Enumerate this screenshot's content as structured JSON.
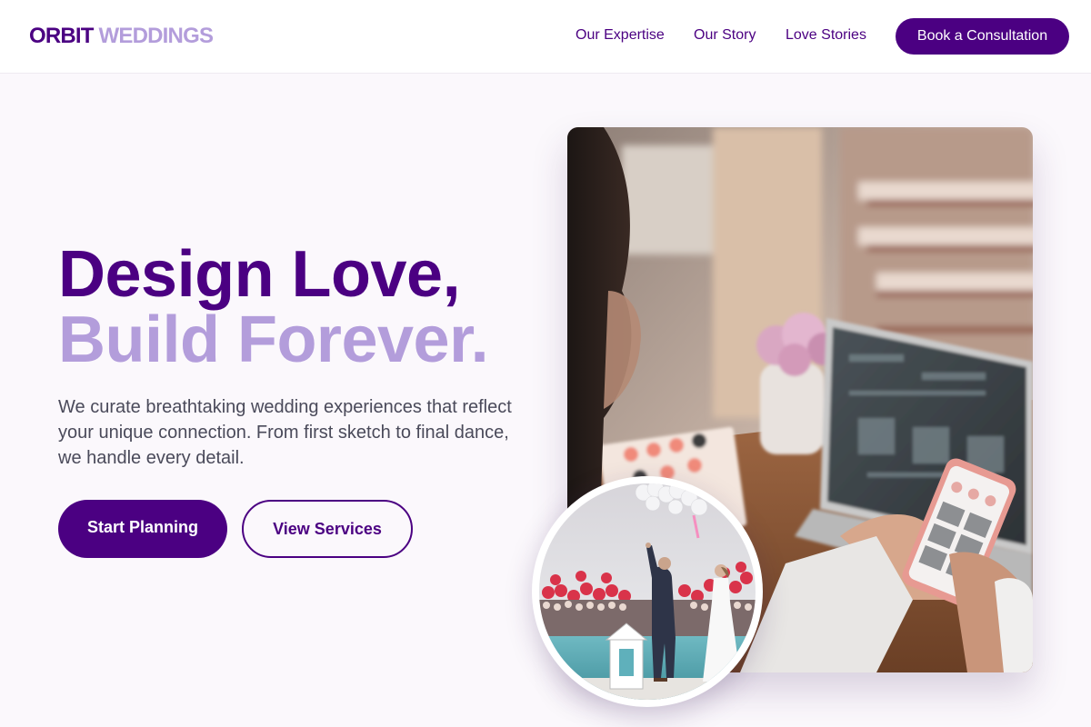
{
  "brand": {
    "part1": "ORBIT",
    "part2": "WEDDINGS"
  },
  "nav": {
    "links": [
      "Our Expertise",
      "Our Story",
      "Love Stories"
    ],
    "cta": "Book a Consultation"
  },
  "hero": {
    "headline_line1": "Design Love,",
    "headline_line2": "Build Forever.",
    "lead": "We curate breathtaking wedding experiences that reflect your unique connection. From first sketch to final dance, we handle every detail.",
    "primary_button": "Start Planning",
    "secondary_button": "View Services"
  },
  "images": {
    "main": "planner-with-laptop-and-phone-photo",
    "inset": "couple-at-outdoor-wedding-photo"
  },
  "colors": {
    "primary": "#4b0082",
    "accent": "#b39ddb",
    "background": "#fbf8fc",
    "text": "#4a4a5a"
  }
}
